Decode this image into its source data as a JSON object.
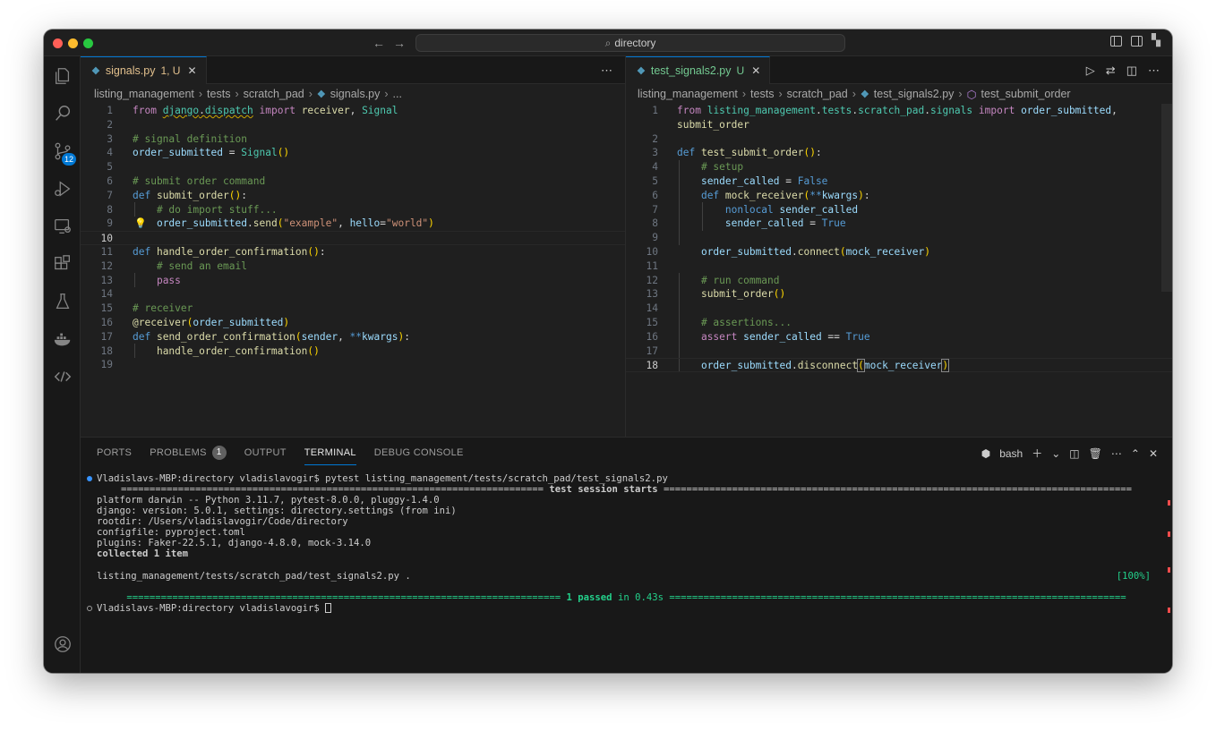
{
  "window": {
    "command_center": "directory",
    "nav_back": "←",
    "nav_forward": "→"
  },
  "activity_bar": {
    "items": [
      "explorer-icon",
      "search-icon",
      "source-control-icon",
      "run-debug-icon",
      "remote-explorer-icon",
      "extensions-icon",
      "testing-icon",
      "docker-icon",
      "live-share-icon"
    ],
    "source_control_badge": "12",
    "bottom": [
      "accounts-icon",
      "settings-gear-icon"
    ]
  },
  "left_editor": {
    "tab": {
      "label": "signals.py",
      "status": "1, U",
      "close": "✕"
    },
    "breadcrumbs": [
      "listing_management",
      "tests",
      "scratch_pad",
      "signals.py",
      "..."
    ],
    "current_line": 10
  },
  "right_editor": {
    "tab": {
      "label": "test_signals2.py",
      "status": "U",
      "close": "✕"
    },
    "breadcrumbs": [
      "listing_management",
      "tests",
      "scratch_pad",
      "test_signals2.py",
      "test_submit_order"
    ],
    "current_line": 18
  },
  "panel": {
    "tabs": [
      "PORTS",
      "PROBLEMS",
      "OUTPUT",
      "TERMINAL",
      "DEBUG CONSOLE"
    ],
    "problems_count": "1",
    "active_tab": "TERMINAL",
    "shell": "bash",
    "terminal": {
      "prompt": "Vladislavs-MBP:directory vladislavogir$",
      "command": "pytest listing_management/tests/scratch_pad/test_signals2.py",
      "session_header": "test session starts",
      "lines": [
        "platform darwin -- Python 3.11.7, pytest-8.0.0, pluggy-1.4.0",
        "django: version: 5.0.1, settings: directory.settings (from ini)",
        "rootdir: /Users/vladislavogir/Code/directory",
        "configfile: pyproject.toml",
        "plugins: Faker-22.5.1, django-4.8.0, mock-3.14.0"
      ],
      "collected": "collected 1 item",
      "test_file": "listing_management/tests/scratch_pad/test_signals2.py .",
      "progress": "[100%]",
      "summary_passed": "1 passed",
      "summary_time": "in 0.43s"
    }
  },
  "colors": {
    "accent": "#0078d4",
    "editor_bg": "#1f1f1f",
    "modified_tab": "#e2c08d",
    "untracked_tab": "#73c991",
    "pass_green": "#23d18b"
  }
}
